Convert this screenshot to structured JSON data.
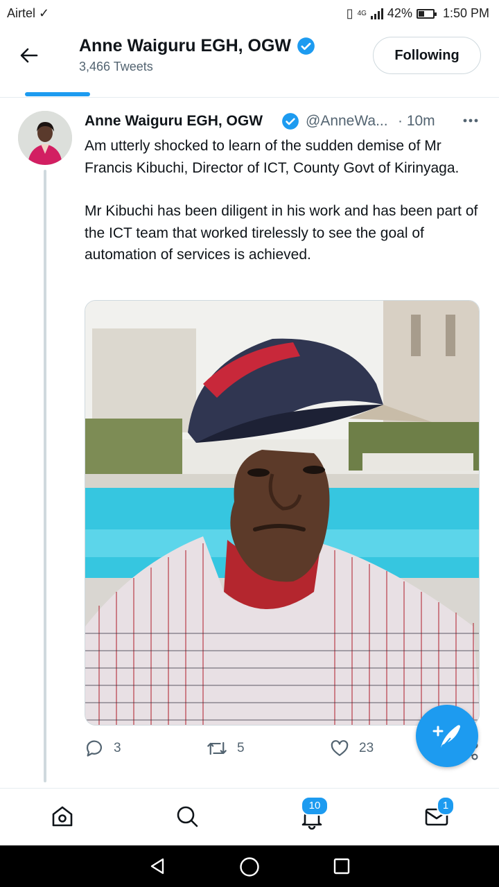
{
  "status_bar": {
    "carrier": "Airtel",
    "network": "4G",
    "battery_percent": "42%",
    "battery_level": 0.42,
    "time": "1:50 PM"
  },
  "header": {
    "title": "Anne Waiguru EGH, OGW",
    "tweet_count": "3,466 Tweets",
    "follow_label": "Following"
  },
  "tweet": {
    "name": "Anne Waiguru EGH, OGW",
    "handle": "@AnneWa...",
    "time": "· 10m",
    "paragraph_1": "Am utterly shocked to learn of the sudden demise of Mr Francis Kibuchi, Director of ICT, County Govt of Kirinyaga.",
    "paragraph_2": "Mr Kibuchi has been diligent in his work and has been part of the ICT team that worked tirelessly to see the goal of automation of services is achieved.",
    "replies": "3",
    "retweets": "5",
    "likes": "23"
  },
  "bottom_nav": {
    "notifications_badge": "10",
    "messages_badge": "1"
  },
  "colors": {
    "accent": "#1d9bf0",
    "text": "#0f1419",
    "secondary": "#536471",
    "border": "#cfd9de"
  },
  "icons": [
    "back-arrow-icon",
    "verified-badge-icon",
    "more-icon",
    "reply-icon",
    "retweet-icon",
    "like-icon",
    "share-icon",
    "compose-icon",
    "home-icon",
    "search-icon",
    "notifications-icon",
    "messages-icon",
    "android-back-icon",
    "android-home-icon",
    "android-recents-icon"
  ]
}
